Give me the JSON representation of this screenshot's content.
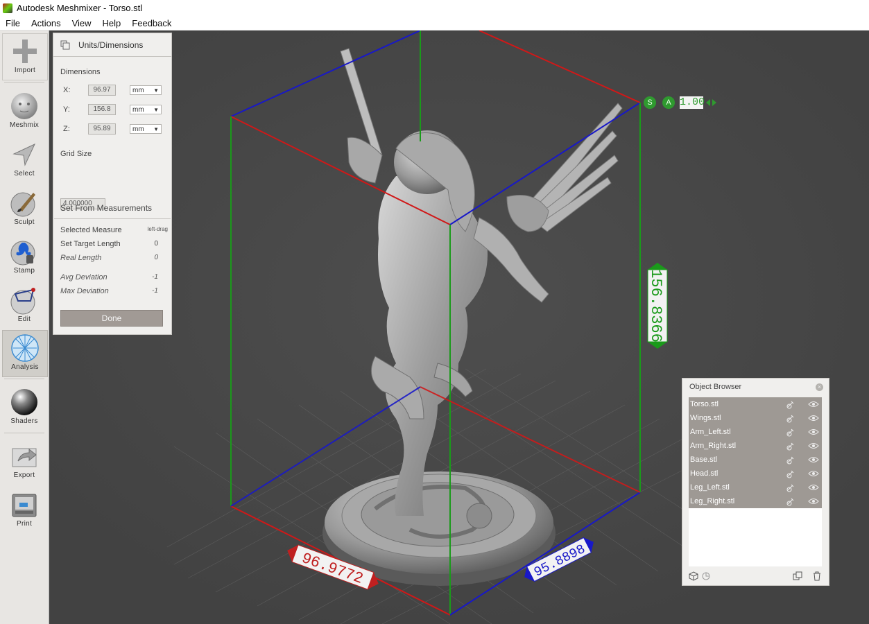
{
  "window": {
    "title": "Autodesk Meshmixer - Torso.stl"
  },
  "menu": [
    "File",
    "Actions",
    "View",
    "Help",
    "Feedback"
  ],
  "toolbar": {
    "import": "Import",
    "meshmix": "Meshmix",
    "select": "Select",
    "sculpt": "Sculpt",
    "stamp": "Stamp",
    "edit": "Edit",
    "analysis": "Analysis",
    "shaders": "Shaders",
    "export": "Export",
    "print": "Print",
    "active": "Analysis"
  },
  "panel": {
    "title": "Units/Dimensions",
    "dimensions_label": "Dimensions",
    "x_label": "X:",
    "x_value": "96.97",
    "x_unit": "mm",
    "y_label": "Y:",
    "y_value": "156.8",
    "y_unit": "mm",
    "z_label": "Z:",
    "z_value": "95.89",
    "z_unit": "mm",
    "grid_size_label": "Grid Size",
    "grid_size_value": "4.000000",
    "set_from_label": "Set From Measurements",
    "selected_measure_label": "Selected Measure",
    "selected_measure_value": "left-drag",
    "set_target_label": "Set Target Length",
    "set_target_value": "0",
    "real_length_label": "Real Length",
    "real_length_value": "0",
    "avg_dev_label": "Avg Deviation",
    "avg_dev_value": "-1",
    "max_dev_label": "Max Deviation",
    "max_dev_value": "-1",
    "done_label": "Done"
  },
  "viewport": {
    "scale_s": "S",
    "scale_a": "A",
    "scale_value": "1.00",
    "height_label": "156.8366",
    "width_label": "96.9772",
    "depth_label": "95.8898",
    "colors": {
      "x_axis": "#d01818",
      "y_axis": "#1a9a1a",
      "z_axis": "#1818c8",
      "background": "#4a4a4a"
    }
  },
  "object_browser": {
    "title": "Object Browser",
    "items": [
      "Torso.stl",
      "Wings.stl",
      "Arm_Left.stl",
      "Arm_Right.stl",
      "Base.stl",
      "Head.stl",
      "Leg_Left.stl",
      "Leg_Right.stl"
    ]
  }
}
